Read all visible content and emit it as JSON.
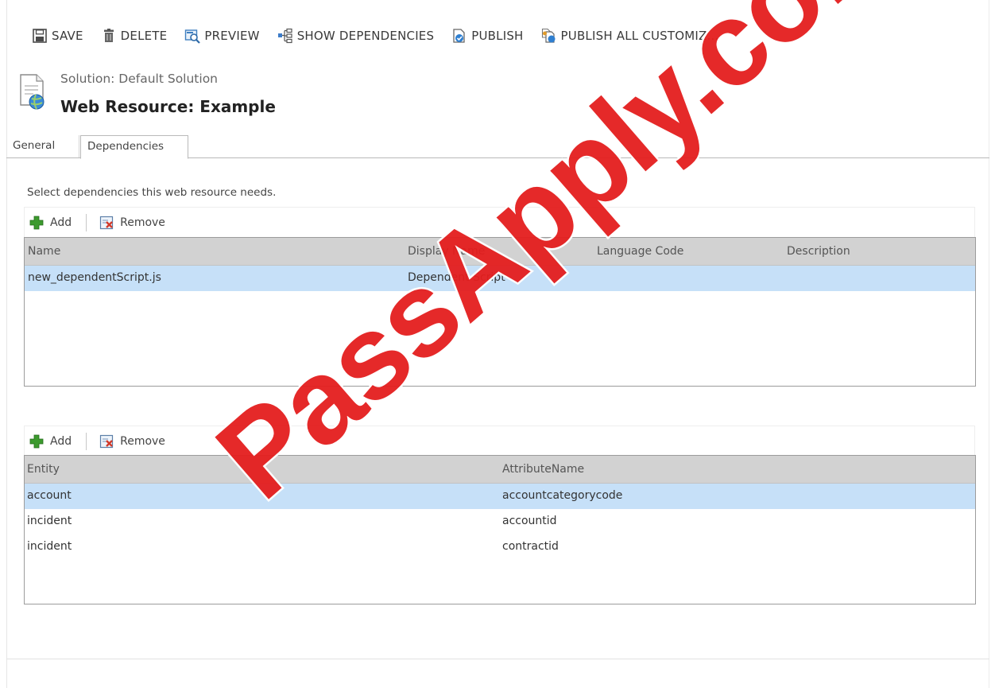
{
  "toolbar": {
    "save_label": "SAVE",
    "delete_label": "DELETE",
    "preview_label": "PREVIEW",
    "show_dependencies_label": "SHOW DEPENDENCIES",
    "publish_label": "PUBLISH",
    "publish_all_label": "PUBLISH ALL CUSTOMIZ..."
  },
  "header": {
    "solution": "Solution: Default Solution",
    "title": "Web Resource: Example"
  },
  "tabs": [
    {
      "label": "General",
      "active": false
    },
    {
      "label": "Dependencies",
      "active": true
    }
  ],
  "instructions": "Select dependencies this web resource needs.",
  "web_resource_grid": {
    "add_label": "Add",
    "remove_label": "Remove",
    "columns": [
      "Name",
      "Display Name",
      "Language Code",
      "Description"
    ],
    "rows": [
      {
        "name": "new_dependentScript.js",
        "display_name": "Dependent Script",
        "language_code": "",
        "description": "",
        "selected": true
      }
    ]
  },
  "attribute_grid": {
    "add_label": "Add",
    "remove_label": "Remove",
    "columns": [
      "Entity",
      "AttributeName"
    ],
    "rows": [
      {
        "entity": "account",
        "attribute": "accountcategorycode",
        "selected": true
      },
      {
        "entity": "incident",
        "attribute": "accountid",
        "selected": false
      },
      {
        "entity": "incident",
        "attribute": "contractid",
        "selected": false
      }
    ]
  },
  "watermark": "PassApply.com",
  "colors": {
    "selected_row": "#c6e0f8",
    "grid_header": "#d2d2d2",
    "watermark": "#e41e1e",
    "add_icon": "#3c9a2e",
    "remove_icon": "#d23a2a"
  },
  "icons": {
    "save": "save-icon",
    "delete": "trash-icon",
    "preview": "preview-icon",
    "show_dependencies": "dependencies-icon",
    "publish": "publish-icon",
    "publish_all": "publish-all-icon",
    "add": "plus-icon",
    "remove": "remove-icon",
    "web_resource": "web-resource-icon"
  }
}
